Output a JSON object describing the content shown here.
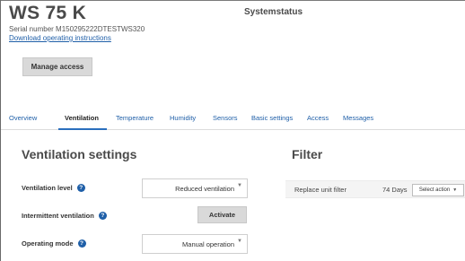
{
  "header": {
    "device_title": "WS 75 K",
    "serial": "Serial number M150295222DTESTWS320",
    "manual_link": "Download operating instructions",
    "system_status": "Systemstatus",
    "manage_access": "Manage access"
  },
  "tabs": [
    {
      "label": "Overview",
      "active": false
    },
    {
      "label": "Ventilation",
      "active": true
    },
    {
      "label": "Temperature",
      "active": false
    },
    {
      "label": "Humidity",
      "active": false
    },
    {
      "label": "Sensors",
      "active": false
    },
    {
      "label": "Basic settings",
      "active": false
    },
    {
      "label": "Access",
      "active": false
    },
    {
      "label": "Messages",
      "active": false
    }
  ],
  "ventilation": {
    "title": "Ventilation settings",
    "level_label": "Ventilation level",
    "level_value": "Reduced ventilation",
    "intermittent_label": "Intermittent ventilation",
    "activate_label": "Activate",
    "mode_label": "Operating mode",
    "mode_value": "Manual operation",
    "help_glyph": "?"
  },
  "filter": {
    "title": "Filter",
    "replace_label": "Replace unit filter",
    "days": "74 Days",
    "select_action": "Select action"
  },
  "colors": {
    "link": "#1f5fa8",
    "accent": "#2a6fbd",
    "button_bg": "#d9d9d9"
  }
}
